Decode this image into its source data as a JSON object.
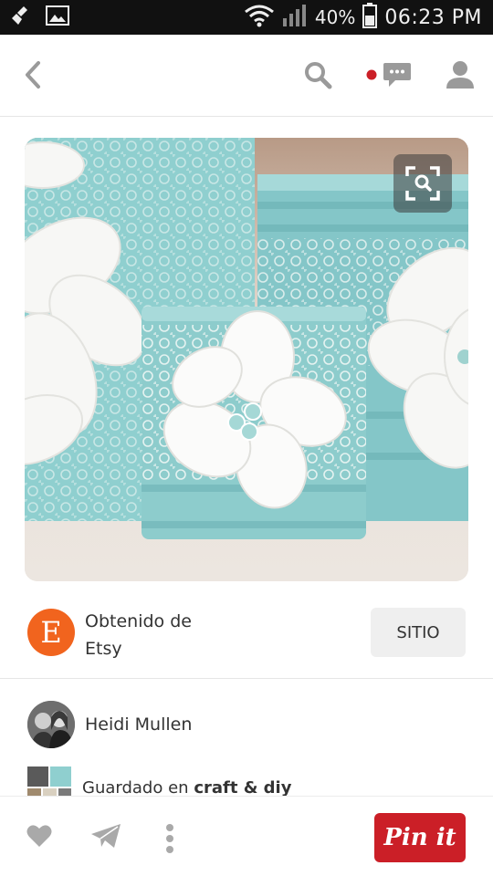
{
  "status_bar": {
    "battery": "40%",
    "time": "06:23",
    "ampm": "PM",
    "icons": [
      "cleaner-icon",
      "gallery-icon",
      "wifi-icon",
      "signal-icon",
      "battery-icon"
    ]
  },
  "header": {
    "icons": [
      "back-arrow-icon",
      "search-icon",
      "notification-dot-icon",
      "chat-bubble-icon",
      "profile-icon"
    ],
    "notification_color": "#cb1f27"
  },
  "pin_image": {
    "visual_search_icon": "visual-search-icon",
    "accent": "#7cc4c6"
  },
  "source": {
    "label": "Obtenido de",
    "name": "Etsy",
    "logo_letter": "E",
    "logo_color": "#f1641e",
    "button_label": "SITIO"
  },
  "pinner": {
    "name": "Heidi Mullen"
  },
  "saved": {
    "prefix": "Guardado en",
    "board": "craft & diy"
  },
  "bottom_bar": {
    "icons": [
      "heart-icon",
      "send-icon",
      "more-dots-icon"
    ],
    "pin_button_label": "Pin it",
    "pin_button_color": "#cb1f27"
  }
}
